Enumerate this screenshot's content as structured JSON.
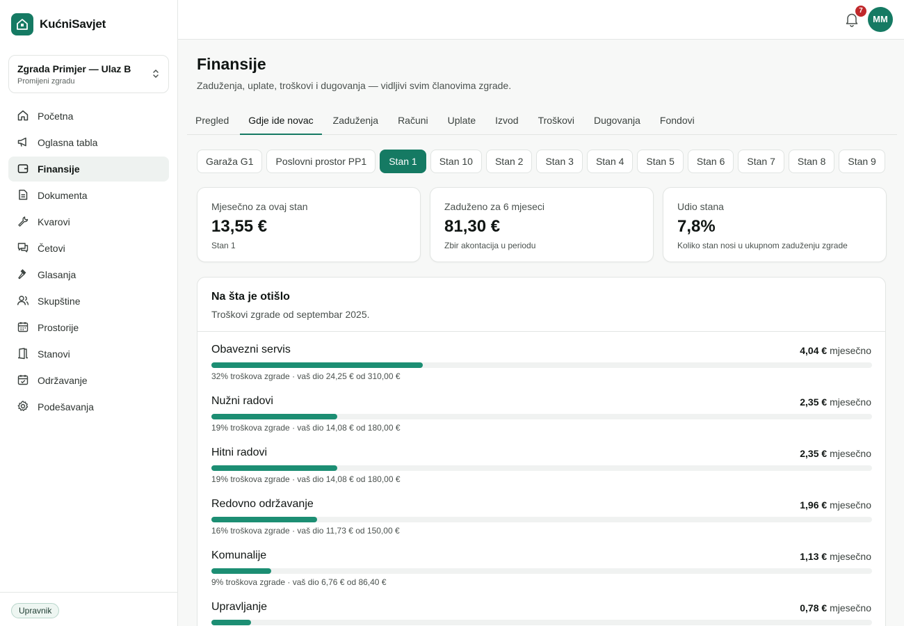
{
  "app": {
    "name": "KućniSavjet"
  },
  "building": {
    "name": "Zgrada Primjer — Ulaz B",
    "change_label": "Promijeni zgradu"
  },
  "nav": [
    {
      "label": "Početna",
      "icon": "home-icon"
    },
    {
      "label": "Oglasna tabla",
      "icon": "megaphone-icon"
    },
    {
      "label": "Finansije",
      "icon": "wallet-icon",
      "active": true
    },
    {
      "label": "Dokumenta",
      "icon": "document-icon"
    },
    {
      "label": "Kvarovi",
      "icon": "wrench-icon"
    },
    {
      "label": "Četovi",
      "icon": "chat-icon"
    },
    {
      "label": "Glasanja",
      "icon": "gavel-icon"
    },
    {
      "label": "Skupštine",
      "icon": "users-icon"
    },
    {
      "label": "Prostorije",
      "icon": "calendar-icon"
    },
    {
      "label": "Stanovi",
      "icon": "door-icon"
    },
    {
      "label": "Održavanje",
      "icon": "calendar-check-icon"
    },
    {
      "label": "Podešavanja",
      "icon": "gear-icon"
    }
  ],
  "role": "Upravnik",
  "topbar": {
    "notifications": "7",
    "avatar_initials": "MM"
  },
  "page": {
    "title": "Finansije",
    "subtitle": "Zaduženja, uplate, troškovi i dugovanja — vidljivi svim članovima zgrade."
  },
  "tabs": [
    "Pregled",
    "Gdje ide novac",
    "Zaduženja",
    "Računi",
    "Uplate",
    "Izvod",
    "Troškovi",
    "Dugovanja",
    "Fondovi"
  ],
  "active_tab": "Gdje ide novac",
  "units": [
    "Garaža G1",
    "Poslovni prostor PP1",
    "Stan 1",
    "Stan 10",
    "Stan 2",
    "Stan 3",
    "Stan 4",
    "Stan 5",
    "Stan 6",
    "Stan 7",
    "Stan 8",
    "Stan 9"
  ],
  "active_unit": "Stan 1",
  "stats": [
    {
      "label": "Mjesečno za ovaj stan",
      "value": "13,55 €",
      "note": "Stan 1"
    },
    {
      "label": "Zaduženo za 6 mjeseci",
      "value": "81,30 €",
      "note": "Zbir akontacija u periodu"
    },
    {
      "label": "Udio stana",
      "value": "7,8%",
      "note": "Koliko stan nosi u ukupnom zaduženju zgrade"
    }
  ],
  "breakdown": {
    "title": "Na šta je otišlo",
    "subtitle": "Troškovi zgrade od septembar 2025.",
    "per_month_label": "mjesečno",
    "items": [
      {
        "name": "Obavezni servis",
        "amount": "4,04 €",
        "share": 0.32,
        "note": "32% troškova zgrade · vaš dio 24,25 € od 310,00 €"
      },
      {
        "name": "Nužni radovi",
        "amount": "2,35 €",
        "share": 0.19,
        "note": "19% troškova zgrade · vaš dio 14,08 € od 180,00 €"
      },
      {
        "name": "Hitni radovi",
        "amount": "2,35 €",
        "share": 0.19,
        "note": "19% troškova zgrade · vaš dio 14,08 € od 180,00 €"
      },
      {
        "name": "Redovno održavanje",
        "amount": "1,96 €",
        "share": 0.16,
        "note": "16% troškova zgrade · vaš dio 11,73 € od 150,00 €"
      },
      {
        "name": "Komunalije",
        "amount": "1,13 €",
        "share": 0.09,
        "note": "9% troškova zgrade · vaš dio 6,76 € od 86,40 €"
      },
      {
        "name": "Upravljanje",
        "amount": "0,78 €",
        "share": 0.06,
        "note": ""
      }
    ]
  },
  "colors": {
    "brand": "#157a63",
    "bar": "#1c8e73",
    "badge": "#c0282b"
  }
}
